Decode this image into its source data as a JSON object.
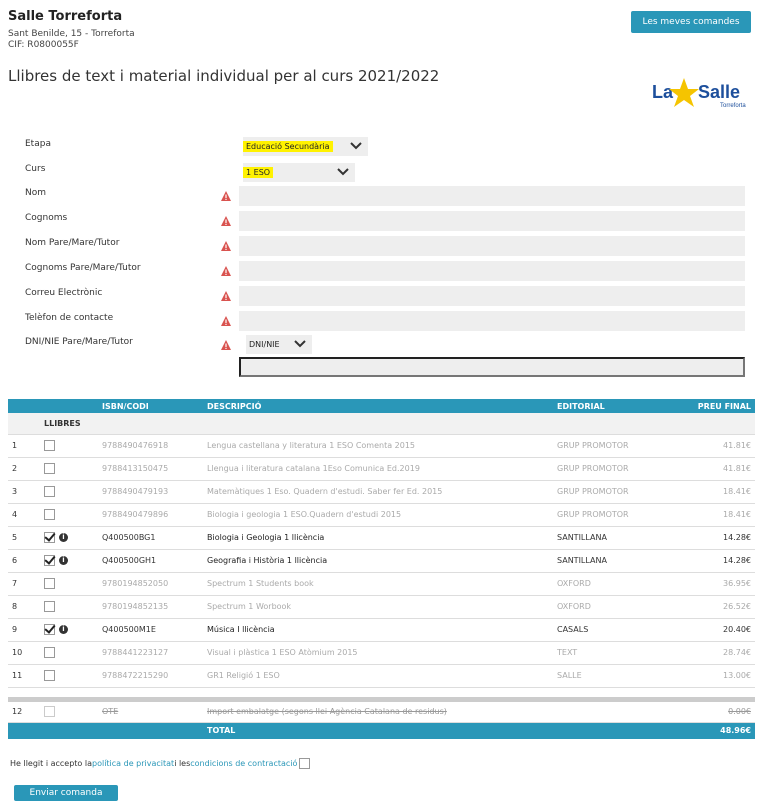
{
  "header": {
    "school_name": "Salle Torreforta",
    "address": "Sant Benilde, 15 - Torreforta",
    "cif": "CIF: R0800055F",
    "orders_button": "Les meves comandes",
    "title": "Llibres de text i material individual per al curs 2021/2022"
  },
  "logo": {
    "text_la": "La",
    "text_salle": "Salle",
    "text_sub": "Torreforta",
    "colors": {
      "blue": "#1d4f9c",
      "star": "#f5c400"
    }
  },
  "form": {
    "etapa_label": "Etapa",
    "etapa_value": "Educació Secundària",
    "curs_label": "Curs",
    "curs_value": "1 ESO",
    "nom_label": "Nom",
    "cognoms_label": "Cognoms",
    "nom_tutor_label": "Nom Pare/Mare/Tutor",
    "cognoms_tutor_label": "Cognoms Pare/Mare/Tutor",
    "email_label": "Correu Electrònic",
    "phone_label": "Telèfon de contacte",
    "dni_label": "DNI/NIE Pare/Mare/Tutor",
    "dni_type": "DNI/NIE"
  },
  "table": {
    "headers": {
      "isbn": "ISBN/CODI",
      "desc": "DESCRIPCIÓ",
      "editorial": "EDITORIAL",
      "price": "PREU FINAL"
    },
    "section_label": "LLIBRES",
    "rows": [
      {
        "n": "1",
        "isbn": "9788490476918",
        "desc": "Lengua castellana y literatura 1 ESO Comenta 2015",
        "editorial": "GRUP PROMOTOR",
        "price": "41.81€"
      },
      {
        "n": "2",
        "isbn": "9788413150475",
        "desc": "Llengua i literatura catalana 1Eso Comunica Ed.2019",
        "editorial": "GRUP PROMOTOR",
        "price": "41.81€"
      },
      {
        "n": "3",
        "isbn": "9788490479193",
        "desc": "Matemàtiques 1 Eso. Quadern d'estudi. Saber fer Ed. 2015",
        "editorial": "GRUP PROMOTOR",
        "price": "18.41€"
      },
      {
        "n": "4",
        "isbn": "9788490479896",
        "desc": "Biologia i geologia 1 ESO.Quadern d'estudi 2015",
        "editorial": "GRUP PROMOTOR",
        "price": "18.41€"
      },
      {
        "n": "5",
        "isbn": "Q400500BG1",
        "desc": "Biologia i Geologia 1 llicència",
        "editorial": "SANTILLANA",
        "price": "14.28€"
      },
      {
        "n": "6",
        "isbn": "Q400500GH1",
        "desc": "Geografia i Història 1 llicència",
        "editorial": "SANTILLANA",
        "price": "14.28€"
      },
      {
        "n": "7",
        "isbn": "9780194852050",
        "desc": "Spectrum 1 Students book",
        "editorial": "OXFORD",
        "price": "36.95€"
      },
      {
        "n": "8",
        "isbn": "9780194852135",
        "desc": "Spectrum 1 Worbook",
        "editorial": "OXFORD",
        "price": "26.52€"
      },
      {
        "n": "9",
        "isbn": "Q400500M1E",
        "desc": "Música I llicència",
        "editorial": "CASALS",
        "price": "20.40€"
      },
      {
        "n": "10",
        "isbn": "9788441223127",
        "desc": "Visual i plàstica 1 ESO Atòmium 2015",
        "editorial": "TEXT",
        "price": "28.74€"
      },
      {
        "n": "11",
        "isbn": "9788472215290",
        "desc": "GR1 Religió 1 ESO",
        "editorial": "SALLE",
        "price": "13.00€"
      }
    ],
    "extra_row": {
      "n": "12",
      "isbn": "OTE",
      "desc": "Import embalatge (segons llei Agència Catalana de residus)",
      "price": "0.00€"
    },
    "total_label": "TOTAL",
    "total_value": "48.96€"
  },
  "footer": {
    "consent_prefix": "He llegit i accepto la ",
    "privacy_link": "política de privacitat",
    "consent_middle": " i les ",
    "terms_link": "condicions de contractació",
    "send_button": "Enviar comanda"
  }
}
